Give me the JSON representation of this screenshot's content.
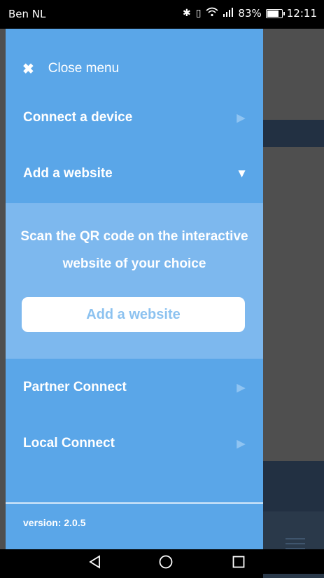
{
  "status_bar": {
    "carrier": "Ben NL",
    "battery_percent": "83%",
    "battery_level": 0.83,
    "time": "12:11",
    "icons": [
      "bluetooth-icon",
      "vibrate-icon",
      "wifi-icon",
      "signal-icon",
      "battery-icon"
    ]
  },
  "drawer": {
    "close_label": "Close menu",
    "items": [
      {
        "label": "Connect a device",
        "icon": "chevron-right-icon"
      },
      {
        "label": "Add a website",
        "icon": "caret-down-icon",
        "expanded": true
      },
      {
        "label": "Partner Connect",
        "icon": "chevron-right-icon"
      },
      {
        "label": "Local Connect",
        "icon": "chevron-right-icon"
      }
    ],
    "add_website_panel": {
      "description": "Scan the QR code on the interactive website of your choice",
      "button_label": "Add a website"
    },
    "version": "version: 2.0.5"
  },
  "nav_bar": {
    "buttons": [
      "back-icon",
      "home-icon",
      "recents-icon"
    ]
  },
  "colors": {
    "drawer": "#5aa6e8",
    "expanded_panel": "#7db8ee",
    "backdrop": "#4f4f4f",
    "app_header": "#223042"
  }
}
